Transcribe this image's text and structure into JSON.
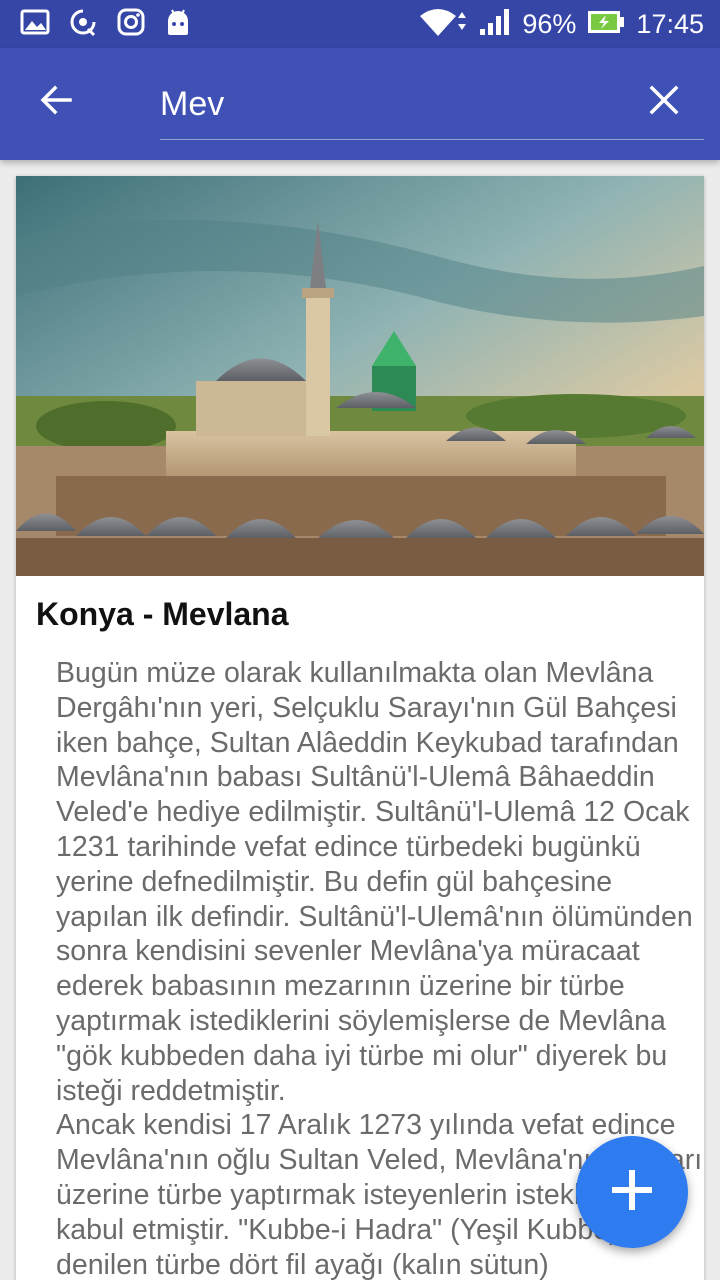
{
  "status_bar": {
    "battery_text": "96%",
    "time": "17:45",
    "icons_left": [
      "image-icon",
      "sync-settings-icon",
      "instagram-icon",
      "android-icon"
    ],
    "icons_right": [
      "wifi-icon",
      "cell-signal-icon",
      "battery-charging-icon"
    ]
  },
  "toolbar": {
    "search_value": "Mev",
    "back_icon": "arrow-back-icon",
    "clear_icon": "close-icon",
    "color": "#3f51b5"
  },
  "card": {
    "title": "Konya - Mevlana",
    "image": "mevlana-museum-photo",
    "paragraph_1": "Bugün müze olarak kullanılmakta olan Mevlâna Dergâhı'nın yeri, Selçuklu Sarayı'nın Gül Bahçesi iken bahçe, Sultan Alâeddin Keykubad tarafından Mevlâna'nın babası Sultânü'l-Ulemâ Bâhaeddin Veled'e hediye edilmiştir. Sultânü'l-Ulemâ 12 Ocak 1231 tarihinde vefat edince türbedeki bugünkü yerine defnedilmiştir. Bu defin gül bahçesine yapılan ilk defindir. Sultânü'l-Ulemâ'nın ölümünden sonra kendisini sevenler Mevlâna'ya müracaat ederek babasının mezarının üzerine bir türbe yaptırmak istediklerini söylemişlerse de Mevlâna \"gök kubbeden daha iyi türbe mi olur\" diyerek bu isteği reddetmiştir.",
    "paragraph_2": "Ancak kendisi 17 Aralık 1273 yılında vefat edince Mevlâna'nın oğlu Sultan Veled, Mevlâna'nın mezarı üzerine türbe yaptırmak isteyenlerin isteklerini kabul etmiştir. \"Kubbe-i Hadra\" (Yeşil Kubbe) denilen türbe dört fil ayağı (kalın sütun)"
  },
  "fab": {
    "icon": "add-icon",
    "color": "#2f7bf0"
  }
}
